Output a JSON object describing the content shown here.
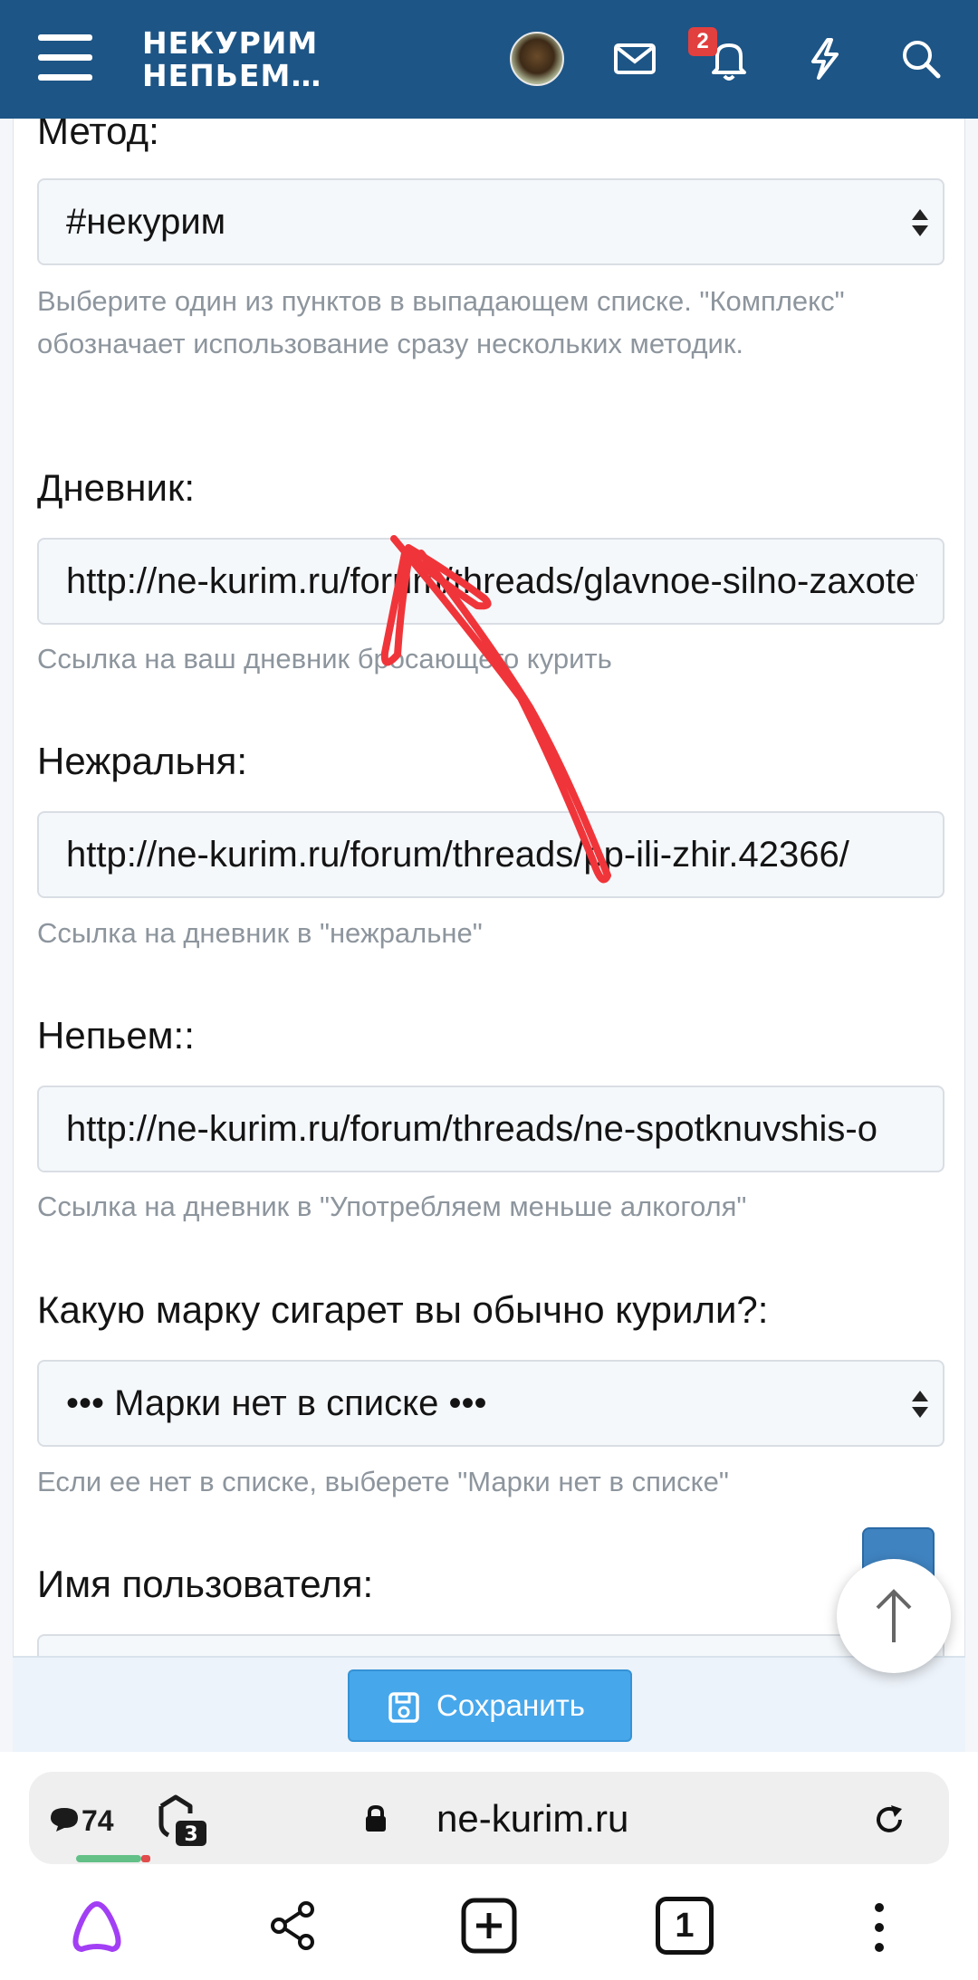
{
  "header": {
    "logo_line1": "НЕКУРИМ",
    "logo_line2": "НЕПЬЕМ…",
    "notification_count": "2"
  },
  "form": {
    "method": {
      "label": "Метод:",
      "value": "#некурим",
      "hint": "Выберите один из пунктов в выпадающем списке. \"Комплекс\" обозначает использование сразу нескольких методик."
    },
    "diary": {
      "label": "Дневник:",
      "value": "http://ne-kurim.ru/forum/threads/glavnoe-silno-zaxotet",
      "hint": "Ссылка на ваш дневник бросающего курить"
    },
    "nezhralnya": {
      "label": "Нежральня:",
      "value": "http://ne-kurim.ru/forum/threads/pp-ili-zhir.42366/",
      "hint": "Ссылка на дневник в \"нежральне\""
    },
    "nepyem": {
      "label": "Непьем::",
      "value": "http://ne-kurim.ru/forum/threads/ne-spotknuvshis-o",
      "hint": "Ссылка на дневник в \"Употребляем меньше алкоголя\""
    },
    "brand": {
      "label": "Какую марку сигарет вы обычно курили?:",
      "value": "••• Марки нет в списке •••",
      "hint": "Если ее нет в списке, выберете \"Марки нет в списке\""
    },
    "username": {
      "label": "Имя пользователя:"
    },
    "save_label": "Сохранить"
  },
  "browser": {
    "comments_count": "74",
    "tabs_badge": "3",
    "url": "ne-kurim.ru",
    "open_tabs": "1"
  },
  "colors": {
    "header_bg": "#1d5586",
    "save_button": "#47a7eb",
    "annotation_arrow": "#f0353a"
  }
}
